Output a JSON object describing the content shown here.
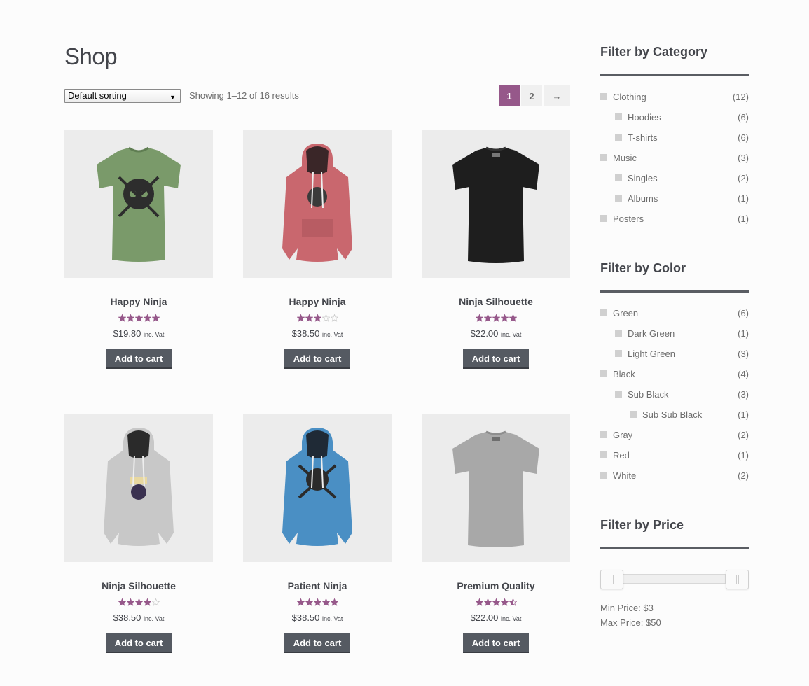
{
  "page": {
    "title": "Shop"
  },
  "toolbar": {
    "sort_selected": "Default sorting",
    "result_count": "Showing 1–12 of 16 results",
    "pages": [
      "1",
      "2"
    ],
    "next_label": "→"
  },
  "colors": {
    "accent": "#96588a",
    "button": "#555a62",
    "star": "#96588a"
  },
  "products": [
    {
      "title": "Happy Ninja",
      "rating": 5,
      "price": "$19.80",
      "tax": "inc. Vat",
      "button": "Add to cart",
      "image": "green-tshirt"
    },
    {
      "title": "Happy Ninja",
      "rating": 3,
      "price": "$38.50",
      "tax": "inc. Vat",
      "button": "Add to cart",
      "image": "red-hoodie"
    },
    {
      "title": "Ninja Silhouette",
      "rating": 5,
      "price": "$22.00",
      "tax": "inc. Vat",
      "button": "Add to cart",
      "image": "black-tshirt"
    },
    {
      "title": "Ninja Silhouette",
      "rating": 4,
      "price": "$38.50",
      "tax": "inc. Vat",
      "button": "Add to cart",
      "image": "gray-hoodie"
    },
    {
      "title": "Patient Ninja",
      "rating": 5,
      "price": "$38.50",
      "tax": "inc. Vat",
      "button": "Add to cart",
      "image": "blue-hoodie"
    },
    {
      "title": "Premium Quality",
      "rating": 4.5,
      "price": "$22.00",
      "tax": "inc. Vat",
      "button": "Add to cart",
      "image": "gray-tshirt"
    }
  ],
  "sidebar": {
    "category": {
      "title": "Filter by Category",
      "items": [
        {
          "label": "Clothing",
          "count": "(12)",
          "level": 0
        },
        {
          "label": "Hoodies",
          "count": "(6)",
          "level": 1
        },
        {
          "label": "T-shirts",
          "count": "(6)",
          "level": 1
        },
        {
          "label": "Music",
          "count": "(3)",
          "level": 0
        },
        {
          "label": "Singles",
          "count": "(2)",
          "level": 1
        },
        {
          "label": "Albums",
          "count": "(1)",
          "level": 1
        },
        {
          "label": "Posters",
          "count": "(1)",
          "level": 0
        }
      ]
    },
    "color": {
      "title": "Filter by Color",
      "items": [
        {
          "label": "Green",
          "count": "(6)",
          "level": 0
        },
        {
          "label": "Dark Green",
          "count": "(1)",
          "level": 1
        },
        {
          "label": "Light Green",
          "count": "(3)",
          "level": 1
        },
        {
          "label": "Black",
          "count": "(4)",
          "level": 0
        },
        {
          "label": "Sub Black",
          "count": "(3)",
          "level": 1
        },
        {
          "label": "Sub Sub Black",
          "count": "(1)",
          "level": 2
        },
        {
          "label": "Gray",
          "count": "(2)",
          "level": 0
        },
        {
          "label": "Red",
          "count": "(1)",
          "level": 0
        },
        {
          "label": "White",
          "count": "(2)",
          "level": 0
        }
      ]
    },
    "price": {
      "title": "Filter by Price",
      "min_label": "Min Price: $3",
      "max_label": "Max Price: $50",
      "min_value": 3,
      "max_value": 50
    }
  }
}
